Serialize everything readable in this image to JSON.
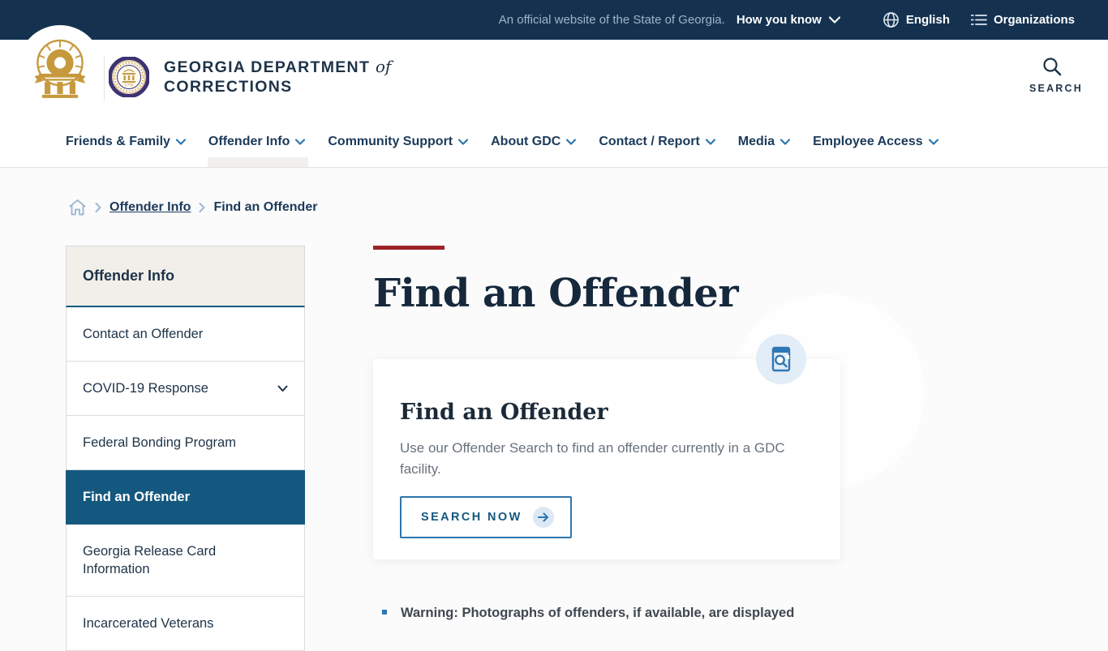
{
  "official_bar": {
    "message": "An official website of the State of Georgia.",
    "how_you_know": "How you know",
    "language": "English",
    "organizations": "Organizations"
  },
  "header": {
    "agency_line1": "GEORGIA DEPARTMENT",
    "agency_of": "of",
    "agency_line2": "CORRECTIONS",
    "search_label": "SEARCH"
  },
  "nav": {
    "items": [
      {
        "label": "Friends & Family",
        "active": false
      },
      {
        "label": "Offender Info",
        "active": true
      },
      {
        "label": "Community Support",
        "active": false
      },
      {
        "label": "About GDC",
        "active": false
      },
      {
        "label": "Contact / Report",
        "active": false
      },
      {
        "label": "Media",
        "active": false
      },
      {
        "label": "Employee Access",
        "active": false
      }
    ]
  },
  "breadcrumb": {
    "link_label": "Offender Info",
    "current_label": "Find an Offender"
  },
  "sidebar": {
    "title": "Offender Info",
    "items": [
      {
        "label": "Contact an Offender",
        "active": false,
        "expandable": false
      },
      {
        "label": "COVID-19 Response",
        "active": false,
        "expandable": true
      },
      {
        "label": "Federal Bonding Program",
        "active": false,
        "expandable": false
      },
      {
        "label": "Find an Offender",
        "active": true,
        "expandable": false
      },
      {
        "label": "Georgia Release Card Information",
        "active": false,
        "expandable": false
      },
      {
        "label": "Incarcerated Veterans",
        "active": false,
        "expandable": false
      }
    ]
  },
  "main": {
    "page_title": "Find an Offender",
    "card": {
      "title": "Find an Offender",
      "description": "Use our Offender Search to find an offender currently in a GDC facility.",
      "button_label": "SEARCH NOW",
      "icon": "document-search-icon"
    },
    "warning": "Warning: Photographs of offenders, if available, are displayed"
  },
  "colors": {
    "topbar_bg": "#143250",
    "accent_red": "#9c2327",
    "active_blue": "#14587f",
    "link_blue": "#2d76ad",
    "logo_gold": "#c6993d",
    "seal_purple": "#3d3272",
    "sidebar_header_bg": "#f2efea"
  }
}
